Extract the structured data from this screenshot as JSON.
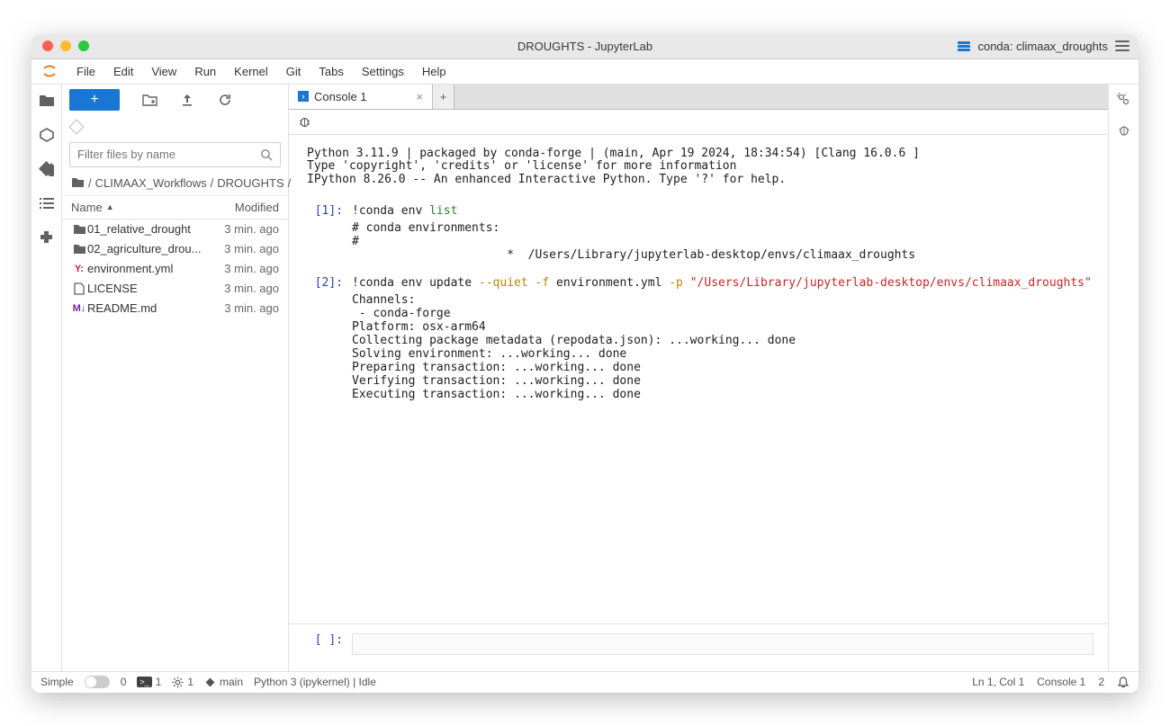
{
  "titlebar": {
    "title": "DROUGHTS - JupyterLab",
    "conda_env": "conda: climaax_droughts"
  },
  "menubar": [
    "File",
    "Edit",
    "View",
    "Run",
    "Kernel",
    "Git",
    "Tabs",
    "Settings",
    "Help"
  ],
  "filebrowser": {
    "search_placeholder": "Filter files by name",
    "breadcrumbs": [
      "CLIMAAX_Workflows",
      "DROUGHTS"
    ],
    "columns": {
      "name": "Name",
      "modified": "Modified"
    },
    "items": [
      {
        "icon": "folder",
        "name": "01_relative_drought",
        "modified": "3 min. ago"
      },
      {
        "icon": "folder",
        "name": "02_agriculture_drou...",
        "modified": "3 min. ago"
      },
      {
        "icon": "yaml",
        "name": "environment.yml",
        "modified": "3 min. ago"
      },
      {
        "icon": "file",
        "name": "LICENSE",
        "modified": "3 min. ago"
      },
      {
        "icon": "md",
        "name": "README.md",
        "modified": "3 min. ago"
      }
    ]
  },
  "tabs": [
    {
      "label": "Console 1"
    }
  ],
  "console": {
    "banner": "Python 3.11.9 | packaged by conda-forge | (main, Apr 19 2024, 18:34:54) [Clang 16.0.6 ]\nType 'copyright', 'credits' or 'license' for more information\nIPython 8.26.0 -- An enhanced Interactive Python. Type '?' for help.",
    "cells": [
      {
        "prompt": "[1]:",
        "code_pre": "!conda env ",
        "code_hl": "list",
        "code_post": "",
        "output": "# conda environments:\n#\n                      *  /Users/Library/jupyterlab-desktop/envs/climaax_droughts\n"
      },
      {
        "prompt": "[2]:",
        "code_pre": "!conda env update ",
        "code_amber1": "--quiet",
        "code_mid1": " ",
        "code_amber2": "-f",
        "code_mid2": " environment.yml ",
        "code_amber3": "-p",
        "code_mid3": " ",
        "code_red": "\"/Users/Library/jupyterlab-desktop/envs/climaax_droughts\"",
        "output": "Channels:\n - conda-forge\nPlatform: osx-arm64\nCollecting package metadata (repodata.json): ...working... done\nSolving environment: ...working... done\nPreparing transaction: ...working... done\nVerifying transaction: ...working... done\nExecuting transaction: ...working... done"
      }
    ],
    "input_prompt": "[ ]:"
  },
  "statusbar": {
    "simple": "Simple",
    "counts": {
      "tabs": "0",
      "terminals": "1",
      "kernels": "1"
    },
    "branch": "main",
    "kernel": "Python 3 (ipykernel) | Idle",
    "ln": "Ln 1, Col 1",
    "console": "Console 1",
    "right_num": "2"
  }
}
